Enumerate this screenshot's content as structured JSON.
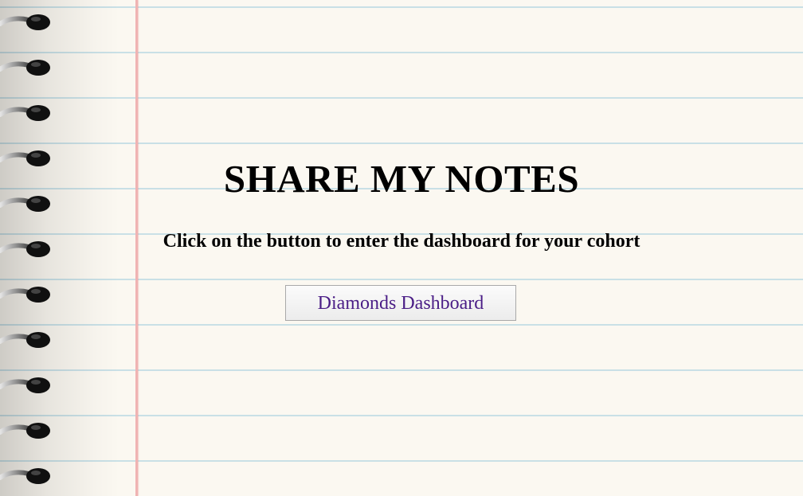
{
  "page": {
    "title": "SHARE MY NOTES",
    "subtitle": "Click on the button to enter the dashboard for your cohort"
  },
  "buttons": {
    "dashboard_label": "Diamonds Dashboard"
  },
  "background": {
    "paper_color": "#fbf8f1",
    "rule_line_color": "#c9e0e6",
    "margin_line_color": "#f0b3b3",
    "decoration": "spiral-binding-rings"
  },
  "colors": {
    "button_text": "#4a1d86"
  }
}
